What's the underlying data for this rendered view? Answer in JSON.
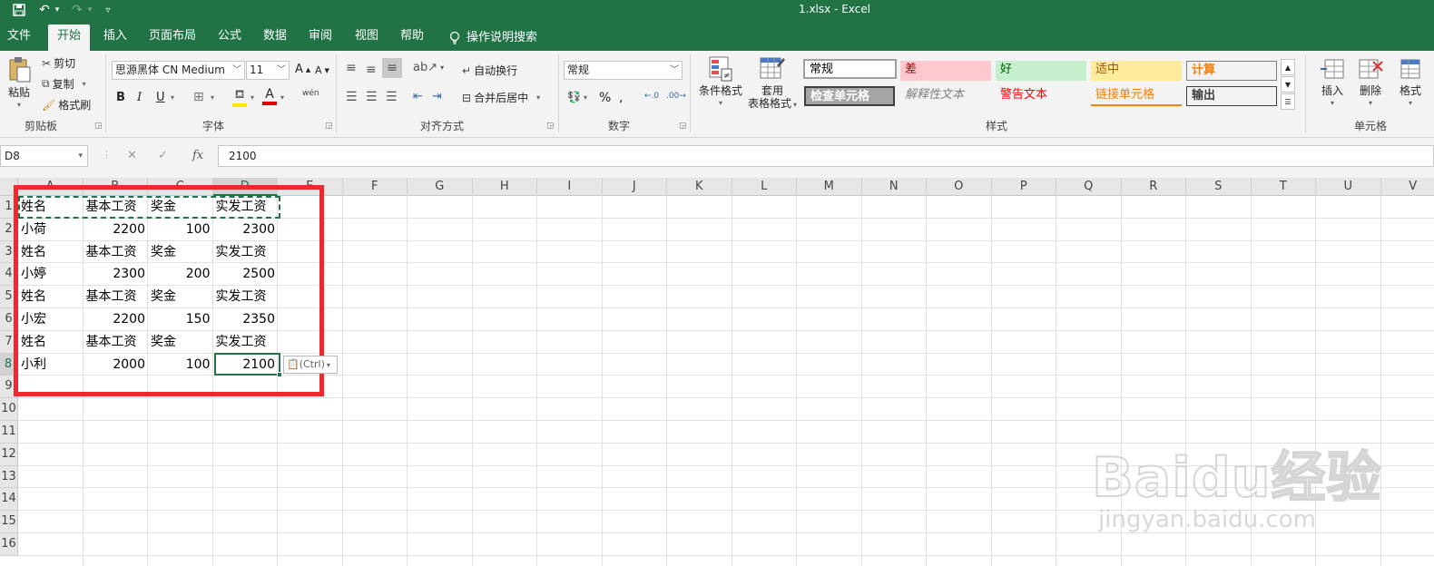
{
  "title_bar": {
    "title": "1.xlsx  -  Excel"
  },
  "tabs": [
    {
      "label": "文件",
      "active": false
    },
    {
      "label": "开始",
      "active": true
    },
    {
      "label": "插入",
      "active": false
    },
    {
      "label": "页面布局",
      "active": false
    },
    {
      "label": "公式",
      "active": false
    },
    {
      "label": "数据",
      "active": false
    },
    {
      "label": "审阅",
      "active": false
    },
    {
      "label": "视图",
      "active": false
    },
    {
      "label": "帮助",
      "active": false
    }
  ],
  "tell_me": "操作说明搜索",
  "ribbon": {
    "clipboard": {
      "paste": "粘贴",
      "cut": "剪切",
      "copy": "复制",
      "format_painter": "格式刷",
      "label": "剪贴板"
    },
    "font": {
      "name": "思源黑体 CN Medium",
      "size": "11",
      "label": "字体",
      "bold": "B",
      "italic": "I",
      "underline": "U",
      "grow": "A",
      "shrink": "A",
      "font_color": "A",
      "phonetic": "wén"
    },
    "alignment": {
      "wrap": "自动换行",
      "merge": "合并后居中",
      "label": "对齐方式"
    },
    "number": {
      "format": "常规",
      "percent": "%",
      "label": "数字"
    },
    "styles": {
      "conditional": "条件格式",
      "table_format_1": "套用",
      "table_format_2": "表格格式",
      "label": "样式",
      "items": [
        "常规",
        "差",
        "好",
        "适中",
        "计算",
        "检查单元格",
        "解释性文本",
        "警告文本",
        "链接单元格",
        "输出"
      ]
    },
    "cells": {
      "insert": "插入",
      "delete": "删除",
      "format": "格式",
      "label": "单元格"
    }
  },
  "formula_bar": {
    "name_box": "D8",
    "value": "2100",
    "fx": "fx"
  },
  "sheet": {
    "columns": [
      "A",
      "B",
      "C",
      "D",
      "E",
      "F",
      "G",
      "H",
      "I",
      "J",
      "K",
      "L",
      "M",
      "N",
      "O",
      "P",
      "Q",
      "R",
      "S",
      "T",
      "U",
      "V"
    ],
    "rows": [
      "1",
      "2",
      "3",
      "4",
      "5",
      "6",
      "7",
      "8",
      "9",
      "10",
      "11",
      "12",
      "13",
      "14",
      "15",
      "16"
    ],
    "data": [
      [
        "姓名",
        "基本工资",
        "奖金",
        "实发工资"
      ],
      [
        "小荷",
        "2200",
        "100",
        "2300"
      ],
      [
        "姓名",
        "基本工资",
        "奖金",
        "实发工资"
      ],
      [
        "小婷",
        "2300",
        "200",
        "2500"
      ],
      [
        "姓名",
        "基本工资",
        "奖金",
        "实发工资"
      ],
      [
        "小宏",
        "2200",
        "150",
        "2350"
      ],
      [
        "姓名",
        "基本工资",
        "奖金",
        "实发工资"
      ],
      [
        "小利",
        "2000",
        "100",
        "2100"
      ]
    ],
    "active_cell": "D8",
    "paste_options": "(Ctrl)"
  },
  "watermark": {
    "logo_text": "Baidu经验",
    "url": "jingyan.baidu.com"
  },
  "colors": {
    "excel_green": "#217346",
    "annotation_red": "#f0272d"
  }
}
